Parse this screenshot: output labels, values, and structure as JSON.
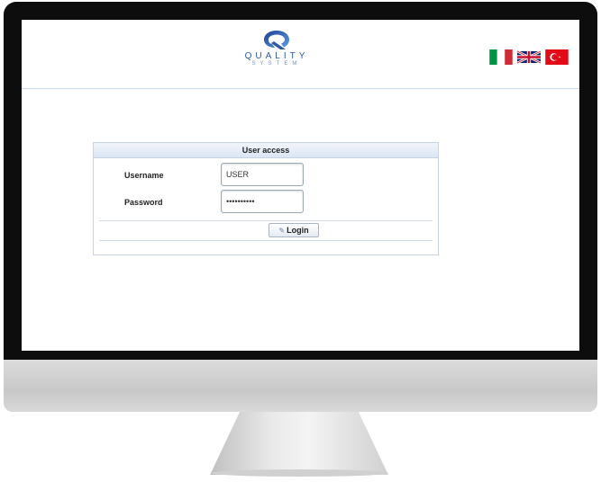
{
  "logo": {
    "wordmark": "QUALITY",
    "subtitle": "SYSTEM"
  },
  "languages": [
    {
      "name": "Italian",
      "icon": "italy-flag-icon"
    },
    {
      "name": "English",
      "icon": "uk-flag-icon"
    },
    {
      "name": "Turkish",
      "icon": "turkey-flag-icon"
    }
  ],
  "login_panel": {
    "title": "User access",
    "username_label": "Username",
    "username_value": "USER",
    "password_label": "Password",
    "password_value": "••••••••••",
    "login_label": "Login",
    "login_icon": "key-icon"
  },
  "colors": {
    "brand": "#2e5aa6",
    "panel_header": "#dbe6f4",
    "bezel": "#0d0d0d"
  }
}
